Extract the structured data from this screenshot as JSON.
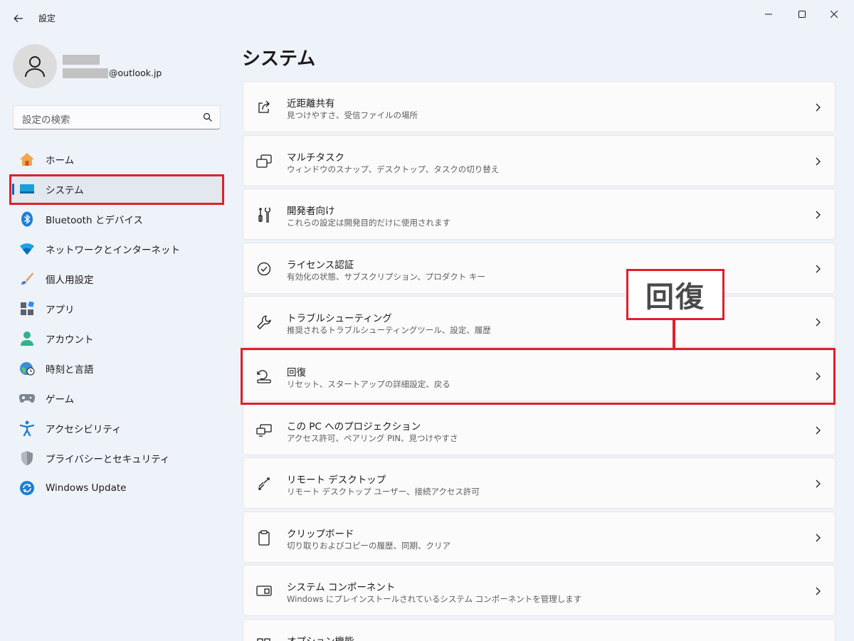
{
  "window": {
    "title": "設定"
  },
  "user": {
    "email_domain": "@outlook.jp"
  },
  "search": {
    "placeholder": "設定の検索"
  },
  "sidebar": {
    "items": [
      {
        "label": "ホーム",
        "icon": "home-icon"
      },
      {
        "label": "システム",
        "icon": "system-icon",
        "active": true
      },
      {
        "label": "Bluetooth とデバイス",
        "icon": "bluetooth-icon"
      },
      {
        "label": "ネットワークとインターネット",
        "icon": "network-icon"
      },
      {
        "label": "個人用設定",
        "icon": "brush-icon"
      },
      {
        "label": "アプリ",
        "icon": "apps-icon"
      },
      {
        "label": "アカウント",
        "icon": "account-icon"
      },
      {
        "label": "時刻と言語",
        "icon": "time-language-icon"
      },
      {
        "label": "ゲーム",
        "icon": "gamepad-icon"
      },
      {
        "label": "アクセシビリティ",
        "icon": "accessibility-icon"
      },
      {
        "label": "プライバシーとセキュリティ",
        "icon": "shield-icon"
      },
      {
        "label": "Windows Update",
        "icon": "update-icon"
      }
    ]
  },
  "main": {
    "title": "システム",
    "cards": [
      {
        "title": "近距離共有",
        "subtitle": "見つけやすさ、受信ファイルの場所",
        "icon": "share-icon"
      },
      {
        "title": "マルチタスク",
        "subtitle": "ウィンドウのスナップ、デスクトップ、タスクの切り替え",
        "icon": "multitask-icon"
      },
      {
        "title": "開発者向け",
        "subtitle": "これらの設定は開発目的だけに使用されます",
        "icon": "developer-icon"
      },
      {
        "title": "ライセンス認証",
        "subtitle": "有効化の状態、サブスクリプション、プロダクト キー",
        "icon": "activation-icon"
      },
      {
        "title": "トラブルシューティング",
        "subtitle": "推奨されるトラブルシューティングツール、設定、履歴",
        "icon": "wrench-icon"
      },
      {
        "title": "回復",
        "subtitle": "リセット、スタートアップの詳細設定、戻る",
        "icon": "recovery-icon"
      },
      {
        "title": "この PC へのプロジェクション",
        "subtitle": "アクセス許可、ペアリング PIN、見つけやすさ",
        "icon": "projection-icon"
      },
      {
        "title": "リモート デスクトップ",
        "subtitle": "リモート デスクトップ ユーザー、接続アクセス許可",
        "icon": "remote-desktop-icon"
      },
      {
        "title": "クリップボード",
        "subtitle": "切り取りおよびコピーの履歴、同期、クリア",
        "icon": "clipboard-icon"
      },
      {
        "title": "システム コンポーネント",
        "subtitle": "Windows にプレインストールされているシステム コンポーネントを管理します",
        "icon": "components-icon"
      },
      {
        "title": "オプション機能",
        "subtitle": "",
        "icon": "optional-features-icon"
      }
    ]
  },
  "annotation": {
    "callout": "回復"
  },
  "colors": {
    "highlight": "#e0202a",
    "accent": "#0a62c4"
  }
}
